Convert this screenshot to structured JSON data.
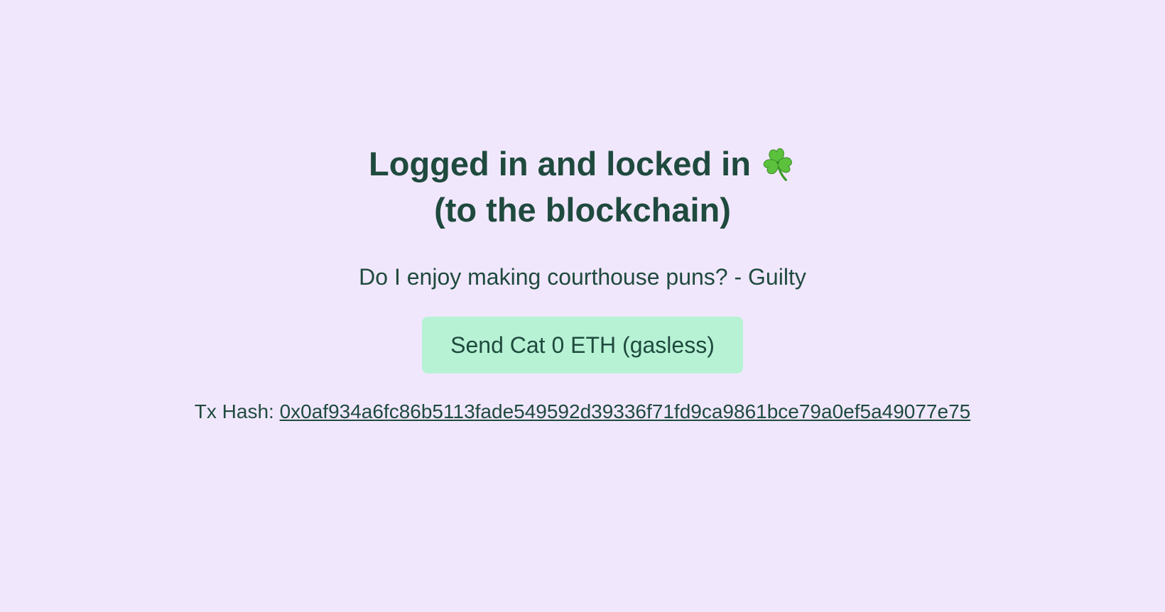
{
  "colors": {
    "background": "#f1e7fd",
    "text": "#1f4a3e",
    "button_bg": "#b7f2d5"
  },
  "heading": {
    "line1": "Logged in and locked in",
    "icon": "shamrock-icon",
    "line2": "(to the blockchain)"
  },
  "subtitle": "Do I enjoy making courthouse puns? - Guilty",
  "send_button": {
    "label": "Send Cat 0 ETH (gasless)"
  },
  "transaction": {
    "label": "Tx Hash:",
    "hash": "0x0af934a6fc86b5113fade549592d39336f71fd9ca9861bce79a0ef5a49077e75"
  }
}
